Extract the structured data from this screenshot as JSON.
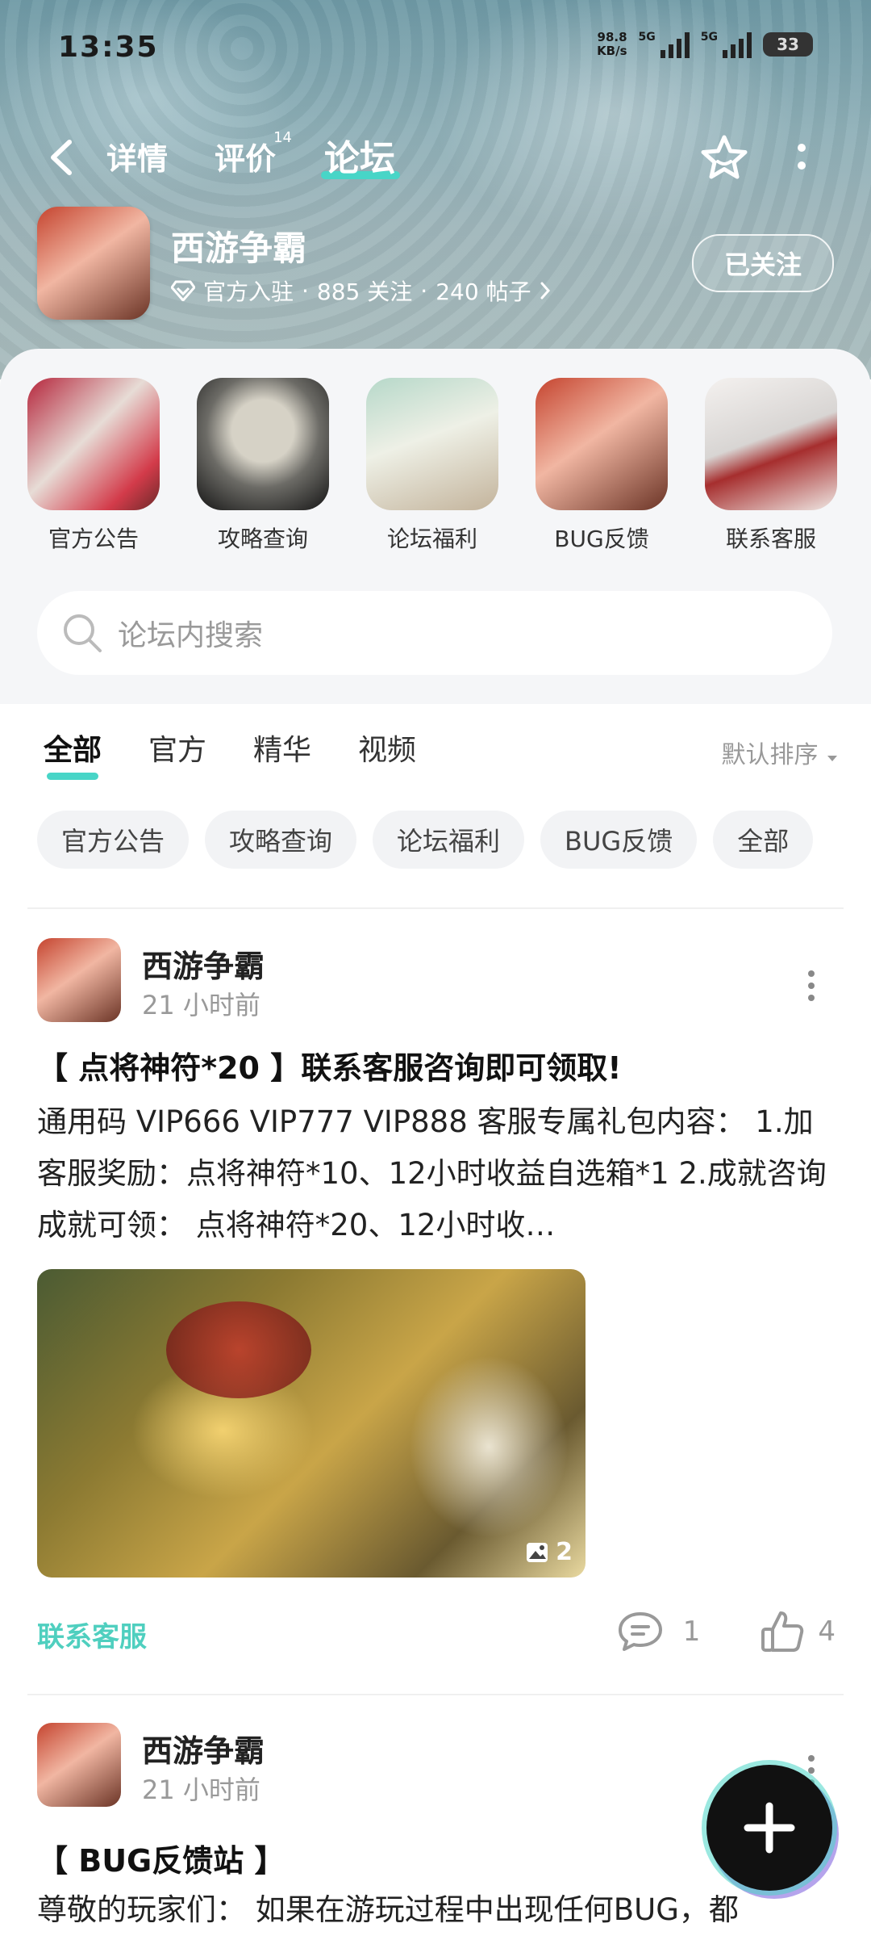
{
  "status_bar": {
    "time": "13:35",
    "speed": "98.8",
    "speed_unit": "KB/s",
    "net1": "5G",
    "net2": "5G",
    "battery": "33"
  },
  "nav": {
    "tabs": [
      {
        "label": "详情"
      },
      {
        "label": "评价",
        "badge": "14"
      },
      {
        "label": "论坛"
      }
    ],
    "active_tab": "论坛"
  },
  "game": {
    "name": "西游争霸",
    "verified": "官方入驻",
    "followers": "885 关注",
    "posts": "240 帖子",
    "follow_label": "已关注"
  },
  "shortcuts": [
    {
      "label": "官方公告"
    },
    {
      "label": "攻略查询"
    },
    {
      "label": "论坛福利"
    },
    {
      "label": "BUG反馈"
    },
    {
      "label": "联系客服"
    }
  ],
  "search": {
    "placeholder": "论坛内搜索"
  },
  "filter_tabs": [
    {
      "label": "全部"
    },
    {
      "label": "官方"
    },
    {
      "label": "精华"
    },
    {
      "label": "视频"
    }
  ],
  "sort_label": "默认排序",
  "chips": [
    {
      "label": "官方公告"
    },
    {
      "label": "攻略查询"
    },
    {
      "label": "论坛福利"
    },
    {
      "label": "BUG反馈"
    },
    {
      "label": "全部"
    }
  ],
  "posts": [
    {
      "author": "西游争霸",
      "time": "21 小时前",
      "title": "【 点将神符*20 】联系客服咨询即可领取!",
      "body": "通用码 VIP666 VIP777 VIP888 客服专属礼包内容： 1.加客服奖励：点将神符*10、12小时收益自选箱*1 2.成就咨询成就可领： 点将神符*20、12小时收…",
      "image_count": "2",
      "tag": "联系客服",
      "comments": "1",
      "likes": "4"
    },
    {
      "author": "西游争霸",
      "time": "21 小时前",
      "title": "【 BUG反馈站 】",
      "body": "尊敬的玩家们： 如果在游玩过程中出现任何BUG，都"
    }
  ],
  "colors": {
    "accent": "#48d5c7",
    "tag": "#4fcfbf"
  },
  "icons": {
    "back": "chevron-left-icon",
    "favorite": "star-icon",
    "more": "more-vertical-icon",
    "search": "search-icon",
    "comment": "comment-icon",
    "like": "thumb-up-icon",
    "compose": "plus-icon"
  }
}
